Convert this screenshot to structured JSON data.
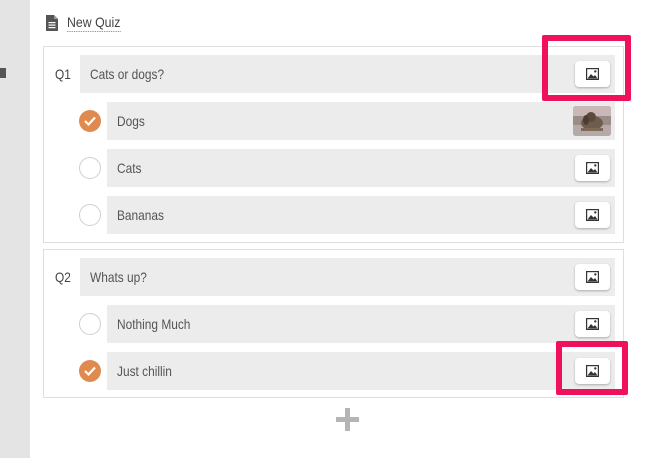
{
  "quiz": {
    "title": "New Quiz"
  },
  "questions": [
    {
      "number": "Q1",
      "text": "Cats or dogs?",
      "answers": [
        {
          "text": "Dogs",
          "correct": true,
          "has_image": true
        },
        {
          "text": "Cats",
          "correct": false,
          "has_image": false
        },
        {
          "text": "Bananas",
          "correct": false,
          "has_image": false
        }
      ]
    },
    {
      "number": "Q2",
      "text": "Whats up?",
      "answers": [
        {
          "text": "Nothing Much",
          "correct": false,
          "has_image": false
        },
        {
          "text": "Just chillin",
          "correct": true,
          "has_image": false
        }
      ]
    }
  ],
  "icons": {
    "header": "document-icon",
    "image_button": "image-icon",
    "correct": "checkmark-icon",
    "add": "plus-icon"
  },
  "colors": {
    "accent": "#df8a4f",
    "highlight": "#ef1159",
    "field_bg": "#ececec"
  }
}
